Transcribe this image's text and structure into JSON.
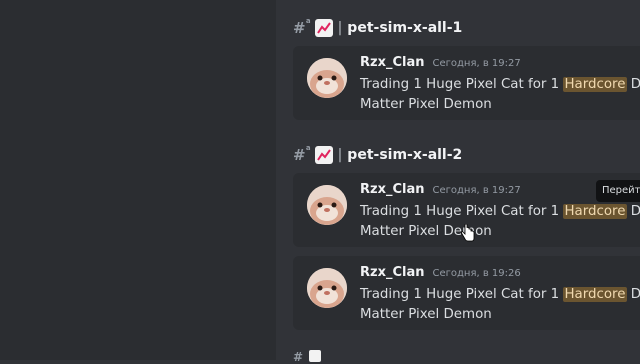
{
  "channels": [
    {
      "name": "pet-sim-x-all-1",
      "messages": [
        {
          "author": "Rzx_Clan",
          "timestamp": "Сегодня, в 19:27",
          "text_before": "Trading 1 Huge Pixel Cat for 1 ",
          "highlight": "Hardcore",
          "text_after": " Dark",
          "line2": "Matter Pixel Demon"
        }
      ]
    },
    {
      "name": "pet-sim-x-all-2",
      "messages": [
        {
          "author": "Rzx_Clan",
          "timestamp": "Сегодня, в 19:27",
          "text_before": "Trading 1 Huge Pixel Cat for 1 ",
          "highlight": "Hardcore",
          "text_after": " Dark",
          "line2": "Matter Pixel Demon"
        },
        {
          "author": "Rzx_Clan",
          "timestamp": "Сегодня, в 19:26",
          "text_before": "Trading 1 Huge Pixel Cat for 1 ",
          "highlight": "Hardcore",
          "text_after": " Dark",
          "line2": "Matter Pixel Demon"
        }
      ]
    }
  ],
  "tooltip": "Перейти",
  "icons": {
    "channel": "hash-icon",
    "emoji": "chart-increasing-icon",
    "cursor": "hand-pointer-icon"
  },
  "colors": {
    "background": "#313338",
    "sidebar": "#2b2d31",
    "highlight": "#6b5530",
    "emoji": "#e0245e"
  }
}
